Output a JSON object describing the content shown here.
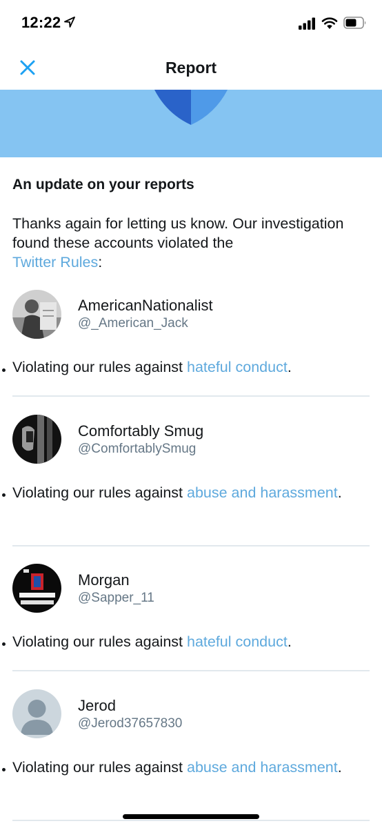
{
  "status_bar": {
    "time": "12:22"
  },
  "nav": {
    "title": "Report"
  },
  "update": {
    "heading": "An update on your reports",
    "intro": "Thanks again for letting us know. Our investigation found these accounts violated the",
    "rules_link": "Twitter Rules",
    "intro_end": ":"
  },
  "accounts": [
    {
      "name": "AmericanNationalist",
      "handle": "@_American_Jack",
      "violation_prefix": "Violating our rules against ",
      "violation_link": "hateful conduct",
      "violation_suffix": "."
    },
    {
      "name": "Comfortably Smug",
      "handle": "@ComfortablySmug",
      "violation_prefix": "Violating our rules against ",
      "violation_link": "abuse and harassment",
      "violation_suffix": "."
    },
    {
      "name": "Morgan",
      "handle": "@Sapper_11",
      "violation_prefix": "Violating our rules against ",
      "violation_link": "hateful conduct",
      "violation_suffix": "."
    },
    {
      "name": "Jerod",
      "handle": "@Jerod37657830",
      "violation_prefix": "Violating our rules against ",
      "violation_link": "abuse and harassment",
      "violation_suffix": "."
    }
  ],
  "colors": {
    "link": "#5ea9dd",
    "banner": "#85c4f2",
    "shield_dark": "#2a63c9",
    "shield_light": "#4f9ae8"
  },
  "icons": {
    "close": "close-icon",
    "location": "location-arrow-icon",
    "signal": "cellular-signal-icon",
    "wifi": "wifi-icon",
    "battery": "battery-icon",
    "shield": "shield-icon"
  }
}
